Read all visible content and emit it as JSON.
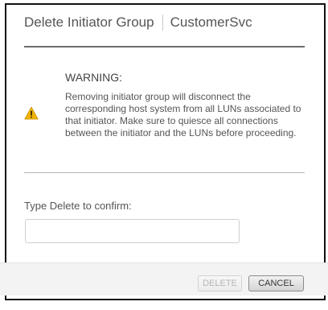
{
  "dialog": {
    "title": "Delete Initiator Group",
    "object_name": "CustomerSvc"
  },
  "warning": {
    "icon": "warning-triangle-icon",
    "icon_color": "#f0b400",
    "heading": "WARNING:",
    "message": "Removing initiator group will disconnect the corresponding host system from all LUNs associated to that initiator. Make sure to quiesce all connections between the initiator and the LUNs before proceeding."
  },
  "confirm": {
    "label": "Type Delete to confirm:",
    "value": "",
    "placeholder": ""
  },
  "buttons": {
    "delete_label": "DELETE",
    "delete_enabled": false,
    "cancel_label": "CANCEL"
  }
}
